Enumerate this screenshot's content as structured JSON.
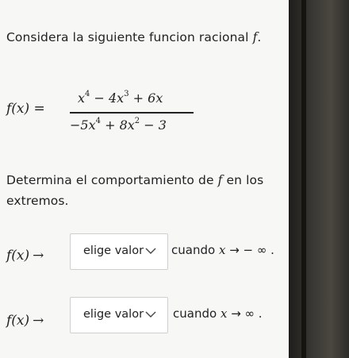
{
  "question": {
    "intro": "Considera la siguiente funcion racional",
    "intro_symbol": "f",
    "intro_end": ".",
    "function_lhs": "f(x) =",
    "numerator": {
      "t1": "x",
      "e1": "4",
      "t2": " − 4x",
      "e2": "3",
      "t3": " + 6x"
    },
    "denominator": {
      "t1": "−5x",
      "e1": "4",
      "t2": " + 8x",
      "e2": "2",
      "t3": " − 3"
    },
    "prompt_line1": "Determina el comportamiento de",
    "prompt_symbol": "f",
    "prompt_line1_end": "en los",
    "prompt_line2": "extremos."
  },
  "rows": [
    {
      "lhs": "f(x)",
      "arrow": "→",
      "select_value": "elige valor",
      "cuando": "cuando",
      "var": "x",
      "target": "→  − ∞ ."
    },
    {
      "lhs": "f(x)",
      "arrow": "→",
      "select_value": "elige valor",
      "cuando": "cuando",
      "var": "x",
      "target": "→  ∞ ."
    }
  ],
  "icons": {
    "dropdown": "chevron-down-icon"
  }
}
